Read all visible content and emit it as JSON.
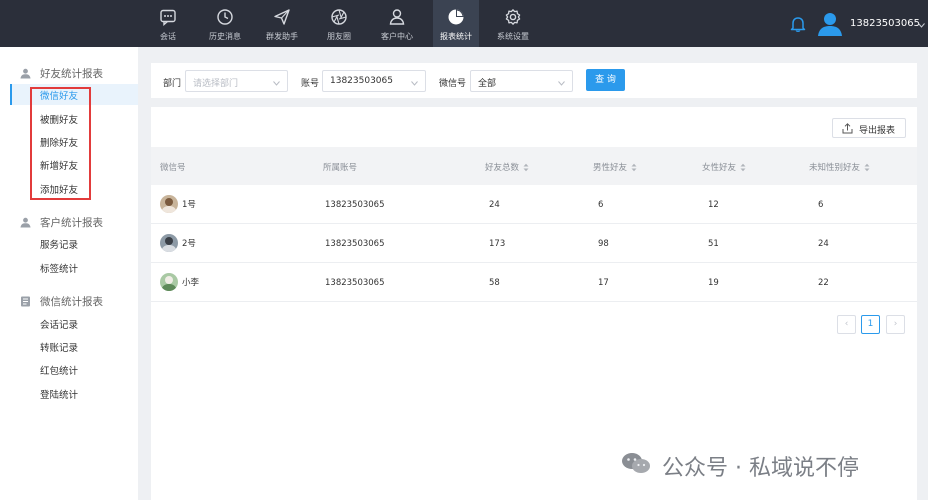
{
  "nav": {
    "items": [
      {
        "label": "会话",
        "icon": "chat-icon"
      },
      {
        "label": "历史消息",
        "icon": "clock-icon"
      },
      {
        "label": "群发助手",
        "icon": "send-icon"
      },
      {
        "label": "朋友圈",
        "icon": "aperture-icon"
      },
      {
        "label": "客户中心",
        "icon": "user-icon"
      },
      {
        "label": "报表统计",
        "icon": "pie-chart-icon",
        "active": true
      },
      {
        "label": "系统设置",
        "icon": "gear-icon"
      }
    ],
    "username": "13823503065"
  },
  "sidebar": {
    "groups": [
      {
        "title": "好友统计报表",
        "icon": "user-icon",
        "items": [
          "微信好友",
          "被删好友",
          "删除好友",
          "新增好友",
          "添加好友"
        ]
      },
      {
        "title": "客户统计报表",
        "icon": "user-icon",
        "items": [
          "服务记录",
          "标签统计"
        ]
      },
      {
        "title": "微信统计报表",
        "icon": "report-icon",
        "items": [
          "会话记录",
          "转账记录",
          "红包统计",
          "登陆统计"
        ]
      }
    ],
    "active_item": "微信好友"
  },
  "filter": {
    "dept_label": "部门",
    "dept_placeholder": "请选择部门",
    "account_label": "账号",
    "account_value": "13823503065",
    "wechat_label": "微信号",
    "wechat_value": "全部",
    "query_label": "查 询"
  },
  "table": {
    "export_label": "导出报表",
    "columns": [
      "微信号",
      "所属账号",
      "好友总数",
      "男性好友",
      "女性好友",
      "未知性别好友"
    ],
    "rows": [
      {
        "name": "1号",
        "account": "13823503065",
        "total": "24",
        "male": "6",
        "female": "12",
        "unknown": "6"
      },
      {
        "name": "2号",
        "account": "13823503065",
        "total": "173",
        "male": "98",
        "female": "51",
        "unknown": "24"
      },
      {
        "name": "小李",
        "account": "13823503065",
        "total": "58",
        "male": "17",
        "female": "19",
        "unknown": "22"
      }
    ]
  },
  "pagination": {
    "prev": "‹",
    "current": "1",
    "next": "›"
  },
  "watermark": {
    "text": "公众号 · 私域说不停"
  },
  "colors": {
    "topbar": "#2b2f3a",
    "accent": "#2b9aec",
    "highlight_box": "#e23b3b"
  }
}
